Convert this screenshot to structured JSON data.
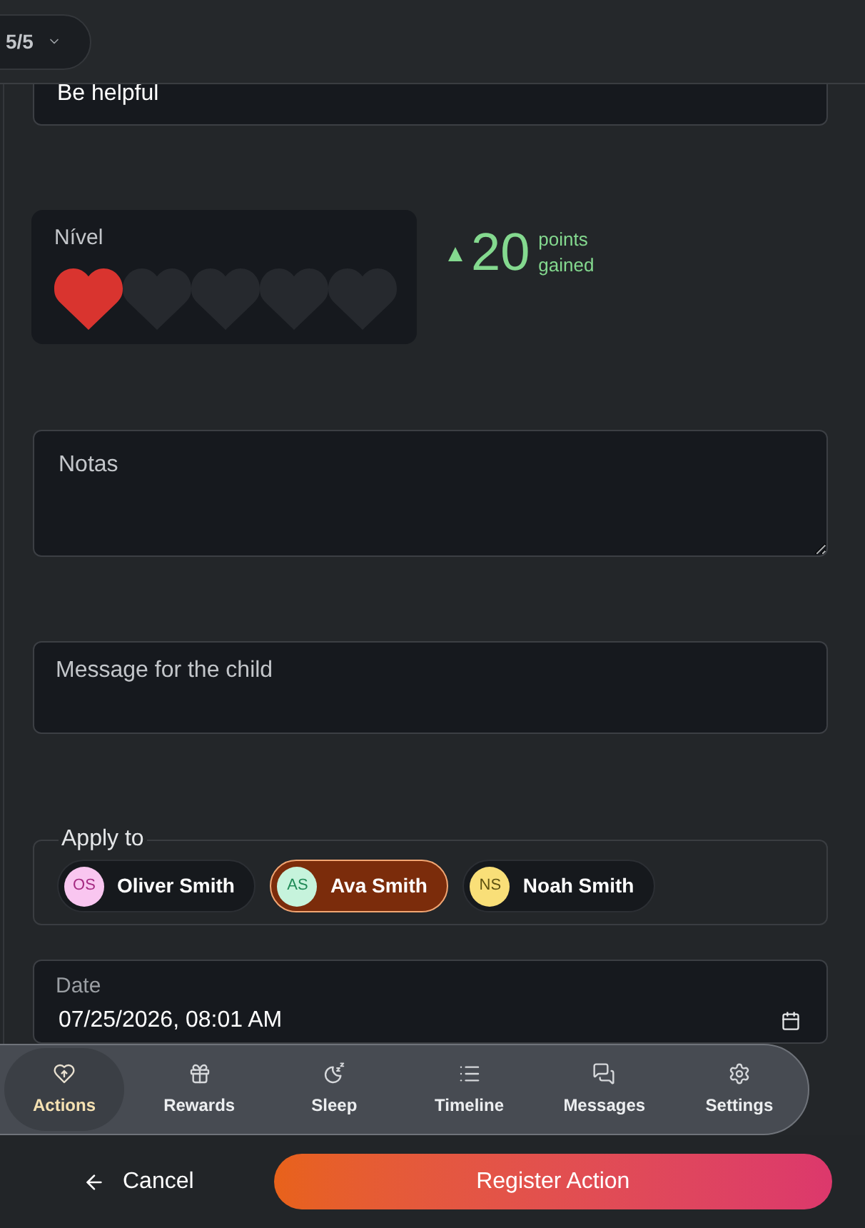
{
  "header": {
    "step_selector": "5/5"
  },
  "action_field": {
    "value": "Be helpful"
  },
  "level_card": {
    "label": "Nível",
    "hearts": [
      {
        "filled": true
      },
      {
        "filled": false
      },
      {
        "filled": false
      },
      {
        "filled": false
      },
      {
        "filled": false
      }
    ]
  },
  "points": {
    "value": "20",
    "caption": "points gained"
  },
  "notes_field": {
    "placeholder": "Notas"
  },
  "message_field": {
    "placeholder": "Message for the child"
  },
  "apply_to": {
    "legend": "Apply to",
    "children": [
      {
        "initials": "OS",
        "name": "Oliver Smith",
        "color": "#f9c6f0",
        "selected": false
      },
      {
        "initials": "AS",
        "name": "Ava Smith",
        "color": "#c6f3dc",
        "selected": true
      },
      {
        "initials": "NS",
        "name": "Noah Smith",
        "color": "#f9df78",
        "selected": false
      }
    ]
  },
  "date_field": {
    "label": "Date",
    "value": "07/25/2026, 08:01 AM"
  },
  "bottom_nav": [
    {
      "label": "Actions",
      "selected": true
    },
    {
      "label": "Rewards",
      "selected": false
    },
    {
      "label": "Sleep",
      "selected": false
    },
    {
      "label": "Timeline",
      "selected": false
    },
    {
      "label": "Messages",
      "selected": false
    },
    {
      "label": "Settings",
      "selected": false
    }
  ],
  "footer": {
    "cancel": "Cancel",
    "submit": "Register Action"
  }
}
